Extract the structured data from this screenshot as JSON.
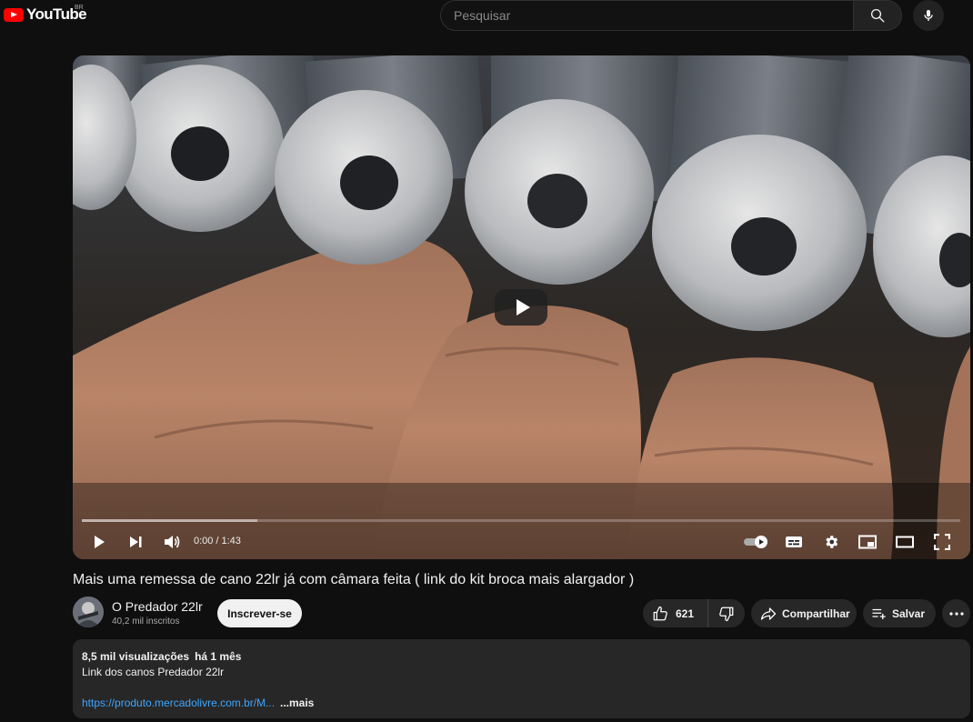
{
  "masthead": {
    "logo_text": "YouTube",
    "region": "BR",
    "search_placeholder": "Pesquisar",
    "icons": [
      "youtube-logo",
      "search-icon",
      "microphone-icon"
    ]
  },
  "player": {
    "current_time": "0:00",
    "separator": "/",
    "duration": "1:43",
    "buffered_fraction": 0.2,
    "icons": [
      "play-icon",
      "next-icon",
      "volume-icon",
      "autoplay-toggle",
      "subtitles-icon",
      "settings-icon",
      "miniplayer-icon",
      "theater-icon",
      "fullscreen-icon"
    ]
  },
  "video": {
    "title": "Mais uma remessa de cano 22lr já com câmara feita ( link do kit broca mais alargador )"
  },
  "channel": {
    "name": "O Predador 22lr",
    "subscribers": "40,2 mil inscritos",
    "subscribe_label": "Inscrever-se"
  },
  "actions": {
    "likes": "621",
    "share_label": "Compartilhar",
    "save_label": "Salvar"
  },
  "description": {
    "views": "8,5 mil visualizações",
    "ago": "há 1 mês",
    "line1": "Link dos canos Predador 22lr",
    "link": "https://produto.mercadolivre.com.br/M...",
    "more_label": "...mais"
  },
  "colors": {
    "background": "#0f0f0f",
    "brand_red": "#ff0000",
    "link_blue": "#3ea6ff",
    "pill_bg": "#272727"
  }
}
